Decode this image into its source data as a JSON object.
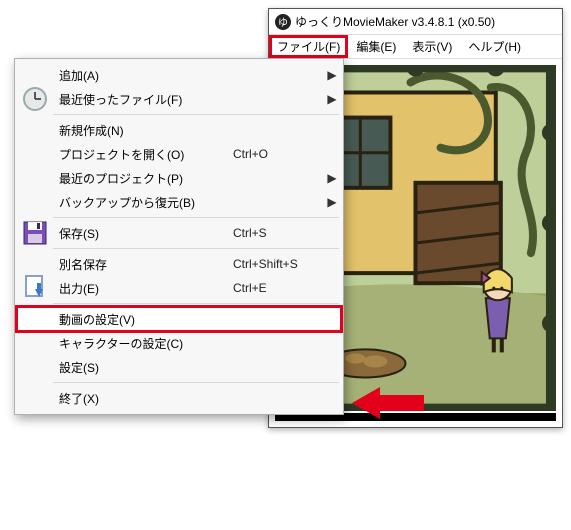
{
  "app": {
    "title": "ゆっくりMovieMaker v3.4.8.1 (x0.50)",
    "icon_glyph": "ゆ"
  },
  "menubar": {
    "items": [
      {
        "label": "ファイル(F)",
        "highlighted": true
      },
      {
        "label": "編集(E)",
        "highlighted": false
      },
      {
        "label": "表示(V)",
        "highlighted": false
      },
      {
        "label": "ヘルプ(H)",
        "highlighted": false
      }
    ]
  },
  "menu": {
    "items": [
      {
        "icon": "",
        "label": "追加(A)",
        "shortcut": "",
        "submenu": true
      },
      {
        "icon": "clock",
        "label": "最近使ったファイル(F)",
        "shortcut": "",
        "submenu": true
      },
      {
        "sep": true
      },
      {
        "icon": "",
        "label": "新規作成(N)",
        "shortcut": "",
        "submenu": false
      },
      {
        "icon": "",
        "label": "プロジェクトを開く(O)",
        "shortcut": "Ctrl+O",
        "submenu": false
      },
      {
        "icon": "",
        "label": "最近のプロジェクト(P)",
        "shortcut": "",
        "submenu": true
      },
      {
        "icon": "",
        "label": "バックアップから復元(B)",
        "shortcut": "",
        "submenu": true
      },
      {
        "sep": true
      },
      {
        "icon": "save",
        "label": "保存(S)",
        "shortcut": "Ctrl+S",
        "submenu": false
      },
      {
        "sep": true
      },
      {
        "icon": "",
        "label": "別名保存",
        "shortcut": "Ctrl+Shift+S",
        "submenu": false
      },
      {
        "icon": "export",
        "label": "出力(E)",
        "shortcut": "Ctrl+E",
        "submenu": false
      },
      {
        "sep": true
      },
      {
        "icon": "",
        "label": "動画の設定(V)",
        "shortcut": "",
        "submenu": false,
        "highlighted": true
      },
      {
        "icon": "",
        "label": "キャラクターの設定(C)",
        "shortcut": "",
        "submenu": false
      },
      {
        "icon": "",
        "label": "設定(S)",
        "shortcut": "",
        "submenu": false
      },
      {
        "sep": true
      },
      {
        "icon": "",
        "label": "終了(X)",
        "shortcut": "",
        "submenu": false
      }
    ]
  },
  "colors": {
    "highlight_red": "#e2001a"
  }
}
